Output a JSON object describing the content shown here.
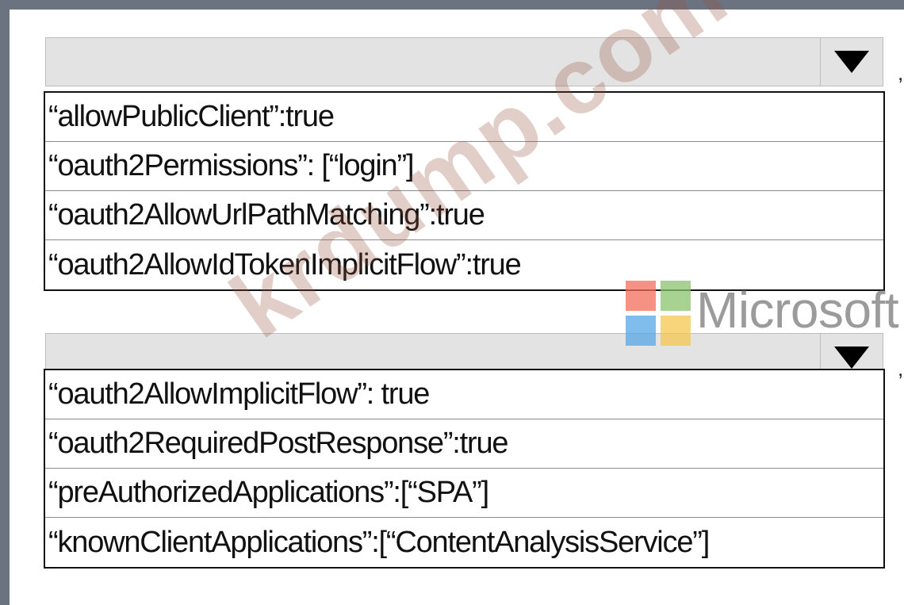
{
  "dropdowns": [
    {
      "trailing": ",",
      "options": [
        "“allowPublicClient”:true",
        "“oauth2Permissions”: [“login”]",
        "“oauth2AllowUrlPathMatching”:true",
        "“oauth2AllowIdTokenImplicitFlow”:true"
      ]
    },
    {
      "trailing": ",",
      "options": [
        "“oauth2AllowImplicitFlow”: true",
        "“oauth2RequiredPostResponse”:true",
        "“preAuthorizedApplications”:[“SPA”]",
        "“knownClientApplications”:[“ContentAnalysisService”]"
      ]
    }
  ],
  "branding": {
    "microsoft_text": "Microsoft",
    "logo_colors": [
      "#f26e5a",
      "#8cc46a",
      "#58a8e6",
      "#f6c64e"
    ]
  },
  "watermark": "krdump.com",
  "icons": {
    "dropdown_arrow": "triangle-down-icon"
  }
}
